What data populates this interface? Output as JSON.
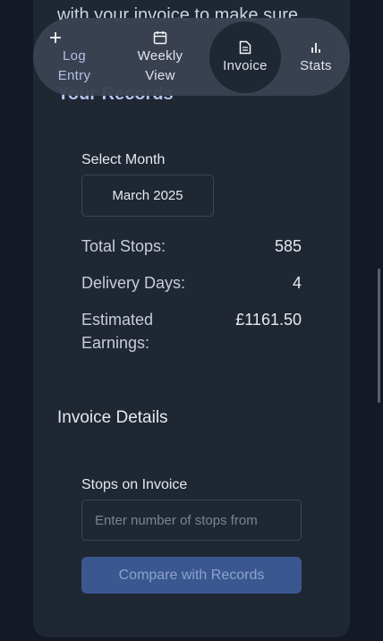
{
  "background_partial_text": "with your invoice to make sure",
  "records_heading": "Your Records",
  "nav": {
    "items": [
      {
        "label_line1": "Log",
        "label_line2": "Entry",
        "icon": "plus-icon"
      },
      {
        "label_line1": "Weekly",
        "label_line2": "View",
        "icon": "calendar-icon"
      },
      {
        "label_line1": "Invoice",
        "label_line2": "",
        "icon": "document-icon",
        "active": true
      },
      {
        "label_line1": "Stats",
        "label_line2": "",
        "icon": "bar-chart-icon"
      }
    ]
  },
  "records": {
    "select_month_label": "Select Month",
    "selected_month": "March 2025",
    "total_stops_label": "Total Stops:",
    "total_stops_value": "585",
    "delivery_days_label": "Delivery Days:",
    "delivery_days_value": "4",
    "estimated_earnings_label": "Estimated Earnings:",
    "estimated_earnings_value": "£1161.50"
  },
  "invoice": {
    "heading": "Invoice Details",
    "stops_label": "Stops on Invoice",
    "stops_placeholder": "Enter number of stops from",
    "stops_value": "",
    "compare_button": "Compare with Records"
  },
  "colors": {
    "background": "#131a26",
    "card": "#1f2733",
    "nav_bg": "#3b4352",
    "button": "#3a5790"
  }
}
